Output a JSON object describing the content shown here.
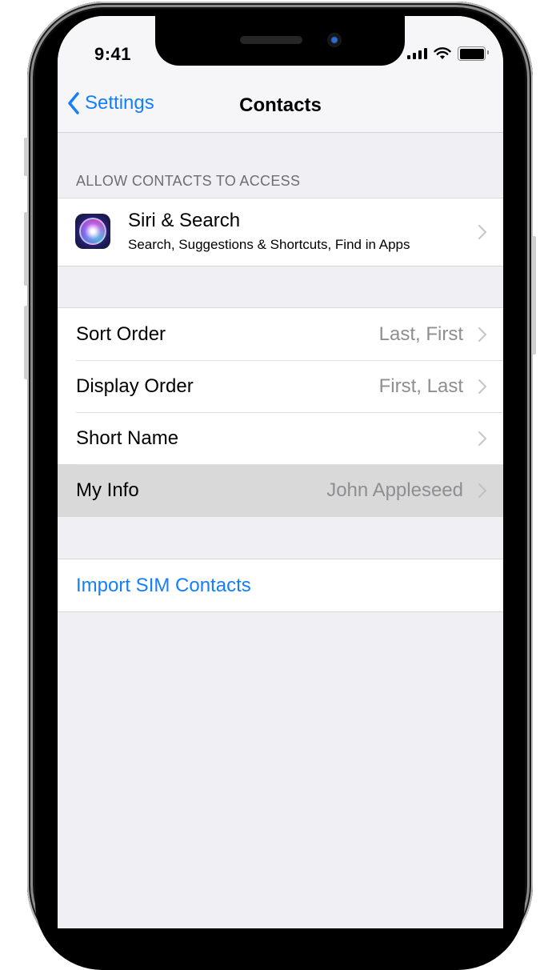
{
  "status_bar": {
    "time": "9:41",
    "icons": [
      "cellular-signal-icon",
      "wifi-icon",
      "battery-icon"
    ]
  },
  "nav": {
    "back_label": "Settings",
    "back_icon": "chevron-left-icon",
    "title": "Contacts"
  },
  "access_section": {
    "header": "ALLOW CONTACTS TO ACCESS",
    "items": [
      {
        "icon": "siri-icon",
        "title": "Siri & Search",
        "subtitle": "Search, Suggestions & Shortcuts, Find in Apps"
      }
    ]
  },
  "settings_section": {
    "items": [
      {
        "label": "Sort Order",
        "value": "Last, First"
      },
      {
        "label": "Display Order",
        "value": "First, Last"
      },
      {
        "label": "Short Name",
        "value": ""
      },
      {
        "label": "My Info",
        "value": "John Appleseed",
        "highlighted": true
      }
    ]
  },
  "actions_section": {
    "import_label": "Import SIM Contacts"
  },
  "colors": {
    "accent": "#147efb",
    "background": "#efeff4",
    "secondary_text": "#8e8e93",
    "highlight": "#d9d9d9"
  }
}
